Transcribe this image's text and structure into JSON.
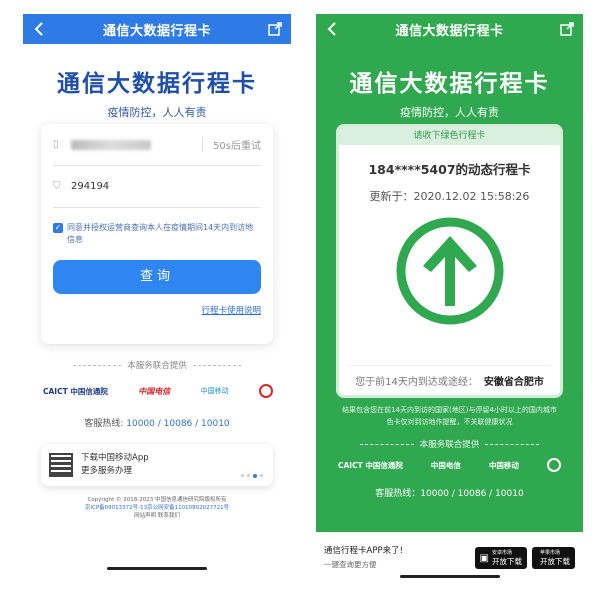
{
  "left": {
    "nav_title": "通信大数据行程卡",
    "hero_title": "通信大数据行程卡",
    "hero_subtitle": "疫情防控，人人有责",
    "retry_text": "50s后重试",
    "code_value": "294194",
    "consent_text": "同意并授权运营商查询本人在疫情期间14天内到访地信息",
    "query_button": "查询",
    "help_link": "行程卡使用说明",
    "provided_by": "本服务联合提供",
    "logos": [
      "CAICT 中国信通院",
      "中国电信",
      "中国移动",
      "中国联通"
    ],
    "hotline_label": "客服热线:",
    "hotline_numbers": "10000 / 10086 / 10010",
    "banner_line1": "下载中国移动App",
    "banner_line2": "更多服务办理",
    "copyright_line1": "Copyright © 2018-2023 中国信息通信研究院版权所有",
    "copyright_line2": "京ICP备09013372号-13京公网安备11010802027721号",
    "copyright_line3": "网站声明 联系我们"
  },
  "right": {
    "nav_title": "通信大数据行程卡",
    "hero_title": "通信大数据行程卡",
    "hero_subtitle": "疫情防控，人人有责",
    "card_tag": "请收下绿色行程卡",
    "dynamic_title": "184****5407的动态行程卡",
    "update_time": "更新于：2020.12.02 15:58:26",
    "route_label": "您于前14天内到达或途经：",
    "route_value": "安徽省合肥市",
    "disclaimer": "结果包含您在前14天内到访的国家(地区)与停留4小时以上的国内城市 色卡仅对到访地作提醒，不关联健康状况",
    "provided_by": "本服务联合提供",
    "logos": [
      "CAICT 中国信通院",
      "中国电信",
      "中国移动",
      "中国联通"
    ],
    "hotline": "客服热线：10000 / 10086 / 10010",
    "bottom_line1": "通信行程卡APP来了!",
    "bottom_line2": "一键查询更方便",
    "android_small": "安卓市场",
    "android_label": "开放下载",
    "ios_small": "苹果市场",
    "ios_label": "开放下载",
    "accent_color": "#2fa84f"
  }
}
